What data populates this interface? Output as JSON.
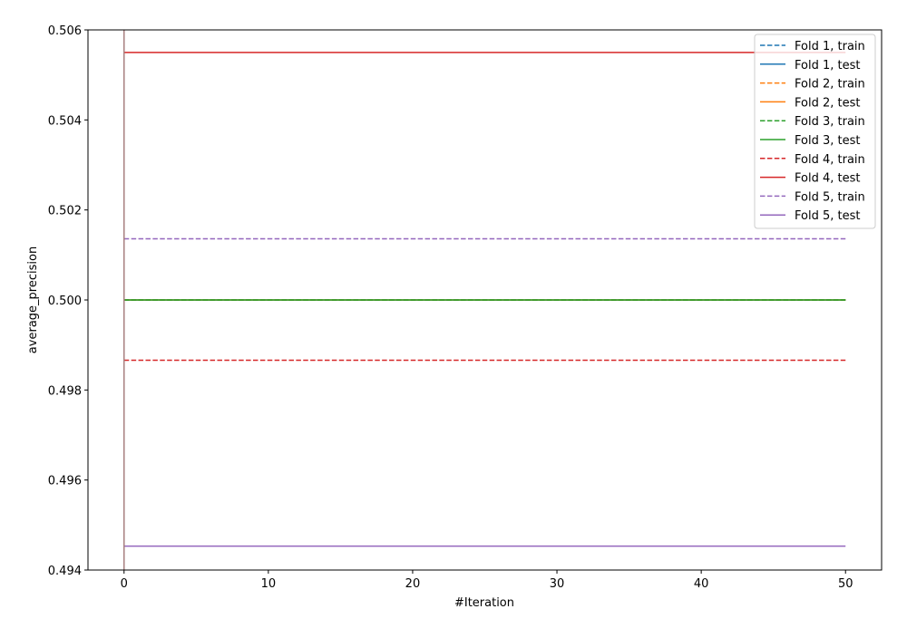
{
  "chart_data": {
    "type": "line",
    "title": "",
    "xlabel": "#Iteration",
    "ylabel": "average_precision",
    "xlim": [
      -2.5,
      52.5
    ],
    "ylim": [
      0.494,
      0.506
    ],
    "xticks": [
      0,
      10,
      20,
      30,
      40,
      50
    ],
    "yticks": [
      "0.494",
      "0.496",
      "0.498",
      "0.500",
      "0.502",
      "0.504",
      "0.506"
    ],
    "grid": false,
    "legend_position": "top-right",
    "x_range": [
      0,
      50
    ],
    "vertical_line": {
      "x": 0,
      "color": "#a88080"
    },
    "series": [
      {
        "name": "Fold 1, train",
        "value": 0.5,
        "color": "#1f77b4",
        "dashed": true
      },
      {
        "name": "Fold 1, test",
        "value": 0.5,
        "color": "#1f77b4",
        "dashed": false
      },
      {
        "name": "Fold 2, train",
        "value": 0.5,
        "color": "#ff7f0e",
        "dashed": true
      },
      {
        "name": "Fold 2, test",
        "value": 0.5,
        "color": "#ff7f0e",
        "dashed": false
      },
      {
        "name": "Fold 3, train",
        "value": 0.5,
        "color": "#2ca02c",
        "dashed": true
      },
      {
        "name": "Fold 3, test",
        "value": 0.5,
        "color": "#2ca02c",
        "dashed": false
      },
      {
        "name": "Fold 4, train",
        "value": 0.49866,
        "color": "#d62728",
        "dashed": true
      },
      {
        "name": "Fold 4, test",
        "value": 0.5055,
        "color": "#d62728",
        "dashed": false
      },
      {
        "name": "Fold 5, train",
        "value": 0.50136,
        "color": "#9467bd",
        "dashed": true
      },
      {
        "name": "Fold 5, test",
        "value": 0.49453,
        "color": "#9467bd",
        "dashed": false
      }
    ]
  }
}
